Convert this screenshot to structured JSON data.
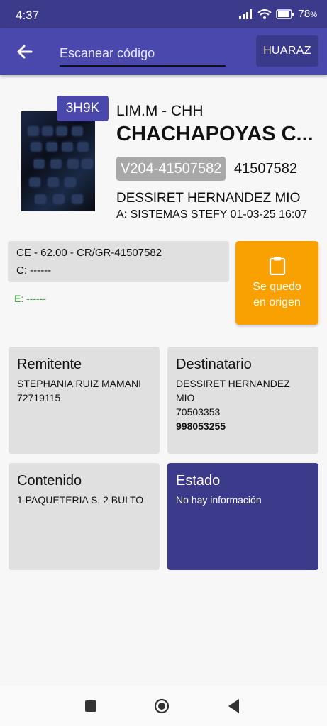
{
  "status_bar": {
    "time": "4:37",
    "battery": "78"
  },
  "app_bar": {
    "search_placeholder": "Escanear código",
    "branch_label": "HUARAZ"
  },
  "shipment": {
    "code": "3H9K",
    "route": "LIM.M - CHH",
    "destination_city": "CHACHAPOYAS C...",
    "guide_chip": "V204-41507582",
    "guide_number": "41507582",
    "receiver_name": "DESSIRET HERNANDEZ MIO",
    "agent_line": "A: SISTEMAS STEFY 01-03-25 16:07"
  },
  "info": {
    "line1": "CE - 62.00 - CR/GR-41507582",
    "line2": "C: ------",
    "line3": "E: ------"
  },
  "status_button": {
    "label_line1": "Se quedo",
    "label_line2": "en origen"
  },
  "cards": {
    "sender": {
      "title": "Remitente",
      "name": "STEPHANIA RUIZ MAMANI",
      "doc": "72719115"
    },
    "recipient": {
      "title": "Destinatario",
      "name": "DESSIRET HERNANDEZ MIO",
      "doc": "70503353",
      "phone": "998053255"
    },
    "content": {
      "title": "Contenido",
      "text": "1 PAQUETERIA S, 2 BULTO"
    },
    "state": {
      "title": "Estado",
      "text": "No hay información"
    }
  },
  "colors": {
    "primary": "#4a48ad",
    "primary_dark": "#3c3a8a",
    "accent_orange": "#f8a100",
    "card_gray": "#e0e0e0",
    "green_text": "#3cae3c"
  }
}
